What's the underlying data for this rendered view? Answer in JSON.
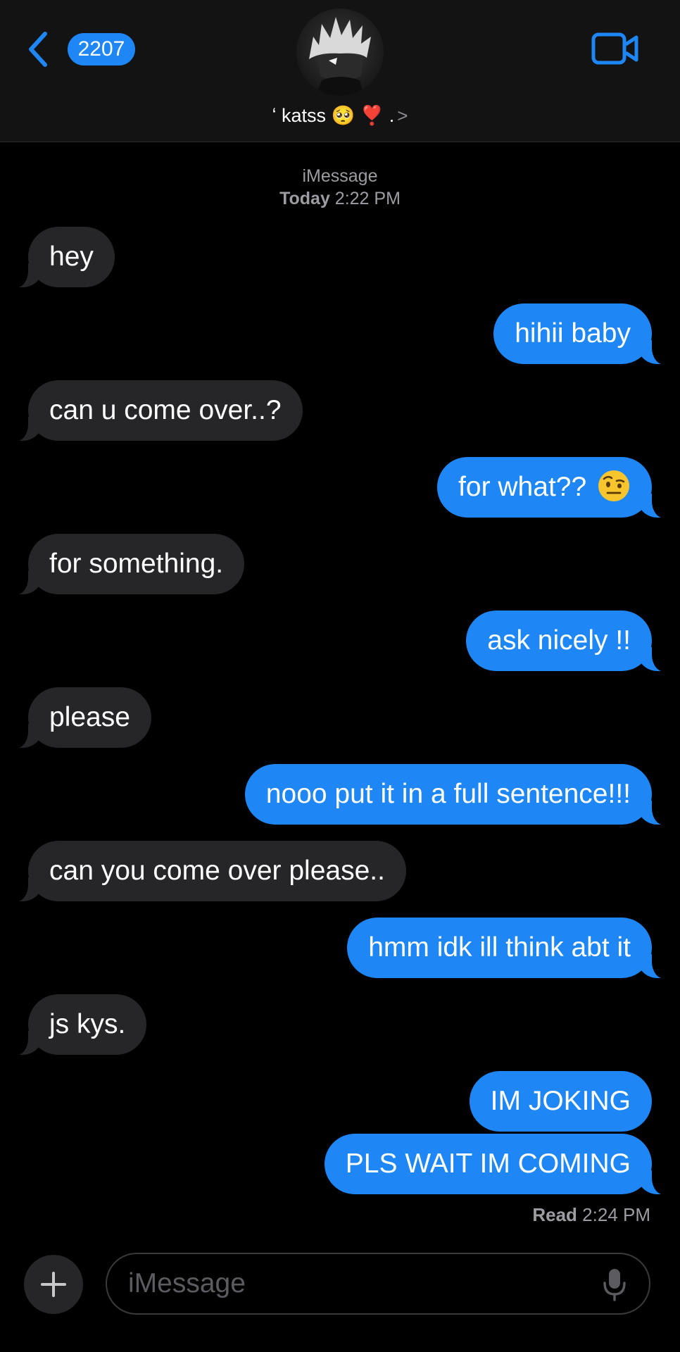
{
  "header": {
    "back_count": "2207",
    "contact_name": "ʻ katss 🥺 ❣️ .",
    "accent_color": "#1e87f5"
  },
  "thread": {
    "service_label": "iMessage",
    "date_label": "Today",
    "time_label": "2:22 PM"
  },
  "messages": [
    {
      "side": "in",
      "text": "hey"
    },
    {
      "side": "out",
      "text": "hihii baby"
    },
    {
      "side": "in",
      "text": "can u come over..?"
    },
    {
      "side": "out",
      "text": "for what??",
      "emoji": "face-with-raised-eyebrow"
    },
    {
      "side": "in",
      "text": "for something."
    },
    {
      "side": "out",
      "text": "ask nicely !!"
    },
    {
      "side": "in",
      "text": "please"
    },
    {
      "side": "out",
      "text": "nooo put it in a full sentence!!!"
    },
    {
      "side": "in",
      "text": "can you come over please.."
    },
    {
      "side": "out",
      "text": "hmm idk ill think abt it"
    },
    {
      "side": "in",
      "text": "js kys."
    },
    {
      "side": "out",
      "text": "IM JOKING"
    },
    {
      "side": "out",
      "text": "PLS WAIT IM COMING"
    }
  ],
  "receipt": {
    "label": "Read",
    "time": "2:24 PM"
  },
  "composer": {
    "placeholder": "iMessage"
  },
  "colors": {
    "incoming_bubble": "#262628",
    "outgoing_bubble": "#1e87f5",
    "header_bg": "#131313"
  }
}
